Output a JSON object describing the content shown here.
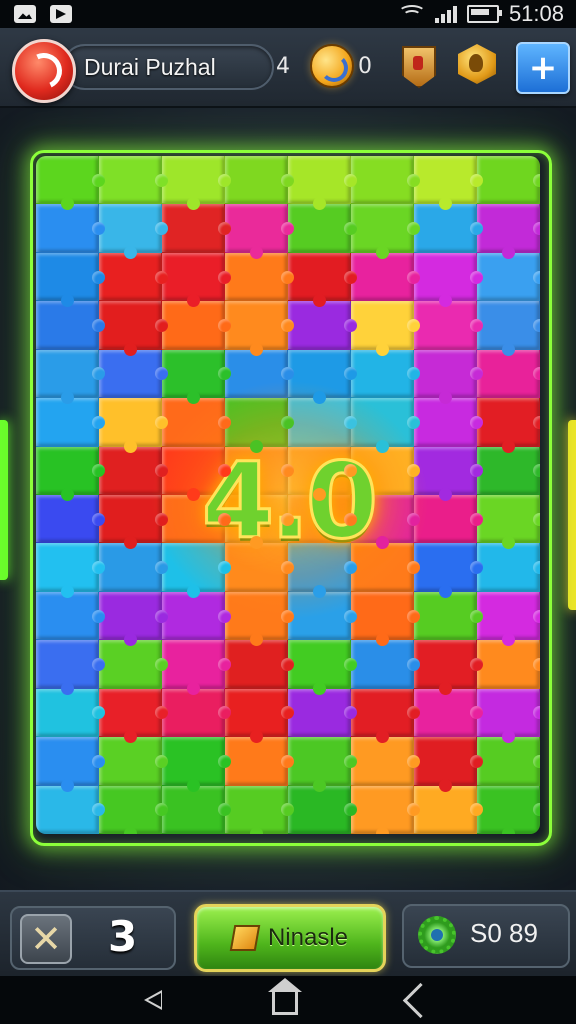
{
  "status_bar": {
    "time": "51:08"
  },
  "header": {
    "title": "Durai Puzhal",
    "level": "4",
    "coins": "0"
  },
  "board": {
    "center_score": "4.0",
    "tile_colors": [
      [
        "#5cd61e",
        "#7fe027",
        "#9ee62a",
        "#7fd820",
        "#a6e628",
        "#86dd22",
        "#b8ea2c",
        "#6fd61f"
      ],
      [
        "#2a8ef0",
        "#39b6e8",
        "#e02424",
        "#ea2a9a",
        "#56cc22",
        "#6ad624",
        "#2aa8e8",
        "#c22ad8"
      ],
      [
        "#1e8ae6",
        "#e82020",
        "#ea1e28",
        "#ff7a1a",
        "#e21c22",
        "#e8229e",
        "#d42ae0",
        "#3aa0f0"
      ],
      [
        "#2a7ae8",
        "#e21e1e",
        "#ff6a18",
        "#ff8a1e",
        "#9a2ae0",
        "#ffd23a",
        "#ea2ab0",
        "#3a8ee8"
      ],
      [
        "#2a9ce8",
        "#3a6ef0",
        "#2cc02a",
        "#2a8ee8",
        "#1e9ae6",
        "#22b4e6",
        "#c62ad6",
        "#e8229a"
      ],
      [
        "#23a4f0",
        "#ffc02a",
        "#ff6a1a",
        "#4ac224",
        "#3ac2e0",
        "#2ac0d8",
        "#c82ae0",
        "#e21e24"
      ],
      [
        "#28c224",
        "#e02020",
        "#ff3a1a",
        "#ff8a1e",
        "#ff9a22",
        "#ffb224",
        "#a22ae0",
        "#2eb82a"
      ],
      [
        "#3a4af0",
        "#e01e1e",
        "#ff6a1a",
        "#ff9a22",
        "#ff7a1e",
        "#e2229e",
        "#ea1e8a",
        "#6ad624"
      ],
      [
        "#22c0f0",
        "#2a9ae6",
        "#1ec0e8",
        "#ff8a1e",
        "#2a9ee8",
        "#ff7a1a",
        "#2a6ef0",
        "#22b8ea"
      ],
      [
        "#2a8ef0",
        "#9a2ae0",
        "#b02ae0",
        "#ff7a1a",
        "#2aa0e8",
        "#ff6a18",
        "#56cc22",
        "#d42ae0"
      ],
      [
        "#3a6ef0",
        "#5ad024",
        "#e8229e",
        "#e02020",
        "#42cc22",
        "#2a8ee8",
        "#e21e24",
        "#ff8a1e"
      ],
      [
        "#20c2e0",
        "#e82028",
        "#ea1e60",
        "#e82020",
        "#9a2ae0",
        "#e21e24",
        "#e8229e",
        "#c42ae0"
      ],
      [
        "#2a8ef0",
        "#5ad024",
        "#2ac224",
        "#ff7a1a",
        "#4cc824",
        "#ff9a22",
        "#e01e22",
        "#56cc22"
      ],
      [
        "#2ab8e8",
        "#46c822",
        "#3ac222",
        "#56cc22",
        "#2ab824",
        "#ff9a22",
        "#ffaa22",
        "#3ac222"
      ]
    ]
  },
  "footer": {
    "lives": "3",
    "main_button_label": "Ninasle",
    "score": "S0 89"
  }
}
